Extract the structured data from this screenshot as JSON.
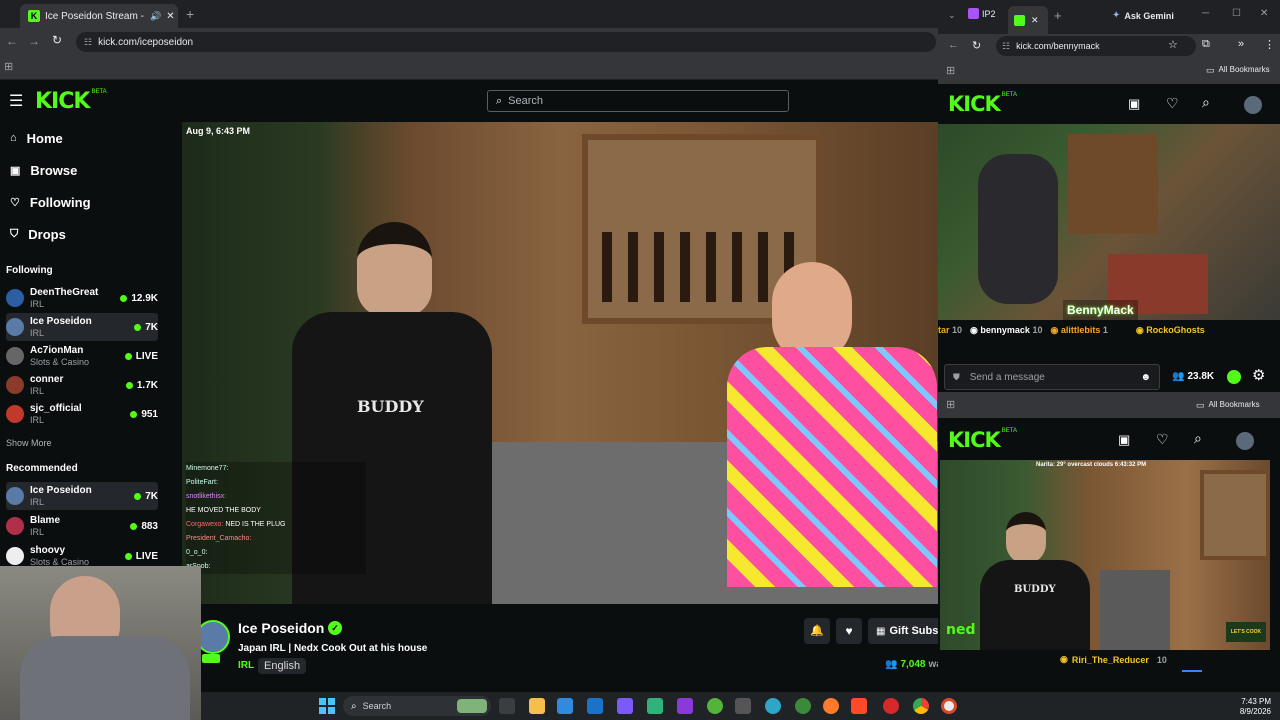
{
  "left_browser": {
    "tab_title": "Ice Poseidon Stream - Wat...",
    "url": "kick.com/iceposeidon",
    "search_placeholder": "Search",
    "kick_logo": "KICK",
    "beta": "BETA",
    "nav": [
      {
        "label": "Home",
        "icon": "home-icon"
      },
      {
        "label": "Browse",
        "icon": "browse-icon"
      },
      {
        "label": "Following",
        "icon": "heart-icon"
      },
      {
        "label": "Drops",
        "icon": "drops-icon"
      }
    ],
    "following_title": "Following",
    "following": [
      {
        "name": "DeenTheGreat",
        "category": "IRL",
        "viewers": "12.9K"
      },
      {
        "name": "Ice Poseidon",
        "category": "IRL",
        "viewers": "7K"
      },
      {
        "name": "Ac7ionMan",
        "category": "Slots & Casino",
        "viewers": "LIVE"
      },
      {
        "name": "conner",
        "category": "IRL",
        "viewers": "1.7K"
      },
      {
        "name": "sjc_official",
        "category": "IRL",
        "viewers": "951"
      }
    ],
    "show_more": "Show More",
    "recommended_title": "Recommended",
    "recommended": [
      {
        "name": "Ice Poseidon",
        "category": "IRL",
        "viewers": "7K"
      },
      {
        "name": "Blame",
        "category": "IRL",
        "viewers": "883"
      },
      {
        "name": "shoovy",
        "category": "Slots & Casino",
        "viewers": "LIVE"
      }
    ],
    "video_timestamp": "Aug 9, 6:43 PM",
    "chat_overlay": [
      {
        "user": "Minemone77:",
        "msg": ""
      },
      {
        "user": "PoliteFart:",
        "msg": ""
      },
      {
        "user": "snotlikethisx:",
        "msg": ""
      },
      {
        "user": "",
        "msg": "HE MOVED THE BODY"
      },
      {
        "user": "Corgawexo:",
        "msg": "NED IS THE PLUG"
      },
      {
        "user": "President_Camacho:",
        "msg": ""
      },
      {
        "user": "0_o_0:",
        "msg": ""
      },
      {
        "user": "arSnob:",
        "msg": ""
      }
    ],
    "streamer_name": "Ice Poseidon",
    "stream_title": "Japan IRL | Nedx Cook Out at his house",
    "tags": [
      "IRL",
      "English"
    ],
    "gift_button": "Gift Subs",
    "viewer_count": "7,048",
    "viewer_suffix": "wa"
  },
  "right_browser_top": {
    "tab1": "IP2",
    "ask": "Ask Gemini",
    "url": "kick.com/bennymack",
    "bookmarks": "All Bookmarks",
    "kick_logo": "KICK",
    "beta": "BETA",
    "overlay_name": "BennyMack",
    "gifters": [
      {
        "name": "tar",
        "count": "10"
      },
      {
        "name": "bennymack",
        "count": "10"
      },
      {
        "name": "alittlebits",
        "count": "1"
      },
      {
        "name": "RockoGhosts",
        "count": ""
      }
    ],
    "chat_placeholder": "Send a message",
    "viewers": "23.8K"
  },
  "right_browser_bottom": {
    "bookmarks": "All Bookmarks",
    "kick_logo": "KICK",
    "beta": "BETA",
    "video_caption": "Narita: 29° overcast clouds 6:43:32 PM",
    "gifter": {
      "name": "Riri_The_Reducer",
      "count": "10"
    },
    "shirt_text": "BUDDY",
    "sign_text": "LET'S COOK"
  },
  "taskbar": {
    "search": "Search",
    "time": "7:43 PM",
    "date": "8/9/2026"
  },
  "colors": {
    "kick_green": "#53fc18",
    "bg": "#0b0e0f",
    "panel": "#191b1f"
  }
}
